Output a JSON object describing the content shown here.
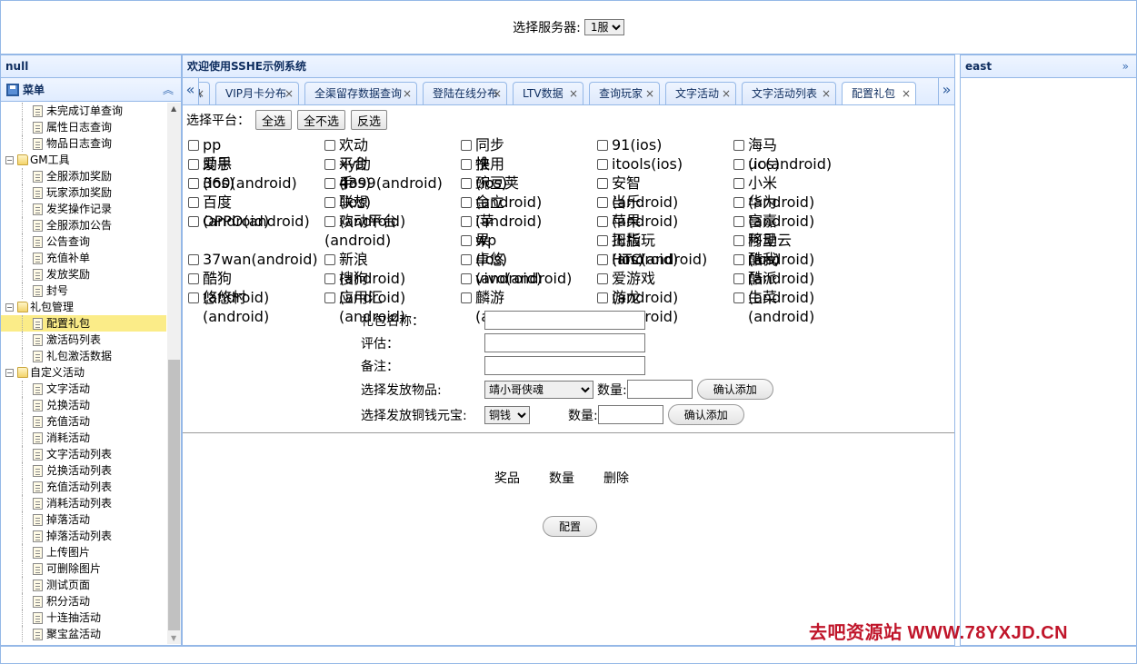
{
  "header": {
    "server_label": "选择服务器:",
    "server_selected": "1服"
  },
  "west": {
    "title": "null",
    "menu_title": "菜单",
    "tree": [
      {
        "label": "未完成订单查询",
        "type": "leaf"
      },
      {
        "label": "属性日志查询",
        "type": "leaf"
      },
      {
        "label": "物品日志查询",
        "type": "leaf"
      },
      {
        "label": "GM工具",
        "type": "folder"
      },
      {
        "label": "全服添加奖励",
        "type": "leaf"
      },
      {
        "label": "玩家添加奖励",
        "type": "leaf"
      },
      {
        "label": "发奖操作记录",
        "type": "leaf"
      },
      {
        "label": "全服添加公告",
        "type": "leaf"
      },
      {
        "label": "公告查询",
        "type": "leaf"
      },
      {
        "label": "充值补单",
        "type": "leaf"
      },
      {
        "label": "发放奖励",
        "type": "leaf"
      },
      {
        "label": "封号",
        "type": "leaf"
      },
      {
        "label": "礼包管理",
        "type": "folder"
      },
      {
        "label": "配置礼包",
        "type": "leaf",
        "selected": true
      },
      {
        "label": "激活码列表",
        "type": "leaf"
      },
      {
        "label": "礼包激活数据",
        "type": "leaf"
      },
      {
        "label": "自定义活动",
        "type": "folder"
      },
      {
        "label": "文字活动",
        "type": "leaf"
      },
      {
        "label": "兑换活动",
        "type": "leaf"
      },
      {
        "label": "充值活动",
        "type": "leaf"
      },
      {
        "label": "消耗活动",
        "type": "leaf"
      },
      {
        "label": "文字活动列表",
        "type": "leaf"
      },
      {
        "label": "兑换活动列表",
        "type": "leaf"
      },
      {
        "label": "充值活动列表",
        "type": "leaf"
      },
      {
        "label": "消耗活动列表",
        "type": "leaf"
      },
      {
        "label": "掉落活动",
        "type": "leaf"
      },
      {
        "label": "掉落活动列表",
        "type": "leaf"
      },
      {
        "label": "上传图片",
        "type": "leaf"
      },
      {
        "label": "可删除图片",
        "type": "leaf"
      },
      {
        "label": "测试页面",
        "type": "leaf"
      },
      {
        "label": "积分活动",
        "type": "leaf"
      },
      {
        "label": "十连抽活动",
        "type": "leaf"
      },
      {
        "label": "聚宝盆活动",
        "type": "leaf"
      }
    ]
  },
  "center": {
    "title": "欢迎使用SSHE示例系统",
    "tabs": [
      "言息",
      "VIP月卡分布",
      "全渠留存数据查询",
      "登陆在线分布",
      "LTV数据",
      "查询玩家",
      "文字活动",
      "文字活动列表",
      "配置礼包"
    ],
    "active_tab": "配置礼包",
    "platform_label": "选择平台：",
    "btn_all": "全选",
    "btn_none": "全不选",
    "btn_invert": "反选",
    "platforms": [
      "pp助手(ios)",
      "欢动平台(ios)",
      "同步推(ios)",
      "91(ios)",
      "海马(ios)",
      "爱思(ios)",
      "xy助手(ios)",
      "快用(ios)",
      "itools(ios)",
      "uc(android)",
      "360(android)",
      "4399(android)",
      "豌豆荚(android)",
      "安智(android)",
      "小米(android)",
      "百度(android)",
      "联想(android)",
      "金立(android)",
      "当乐(android)",
      "华为(android)",
      "OPPO(android)",
      "欢动平台(android)",
      "i苹果(ios)",
      "苹果正版(ios)",
      "富嘉移动(ios)",
      "wp",
      "拇指玩(android)",
      "阿里云(android)",
      "37wan(android)",
      "新浪(android)",
      "卓悠(android)",
      "HTC(android)",
      "酷我(android)",
      "酷狗(android)",
      "搜狗(android)",
      "vivo(android)",
      "爱游戏(android)",
      "酷派(android)",
      "悠悠村(android)",
      "应用汇(android)",
      "麟游(android)",
      "游龙(android)",
      "生菜(android)"
    ],
    "form": {
      "name_label": "礼包名称：",
      "eval_label": "评估：",
      "note_label": "备注：",
      "item_label": "选择发放物品:",
      "item_selected": "靖小哥侠魂",
      "qty_label": "数量:",
      "confirm_add": "确认添加",
      "coin_label": "选择发放铜钱元宝:",
      "coin_selected": "铜钱"
    },
    "result_cols": [
      "奖品",
      "数量",
      "删除"
    ],
    "config_button": "配置"
  },
  "east": {
    "title": "east"
  },
  "watermark": "去吧资源站 WWW.78YXJD.CN"
}
